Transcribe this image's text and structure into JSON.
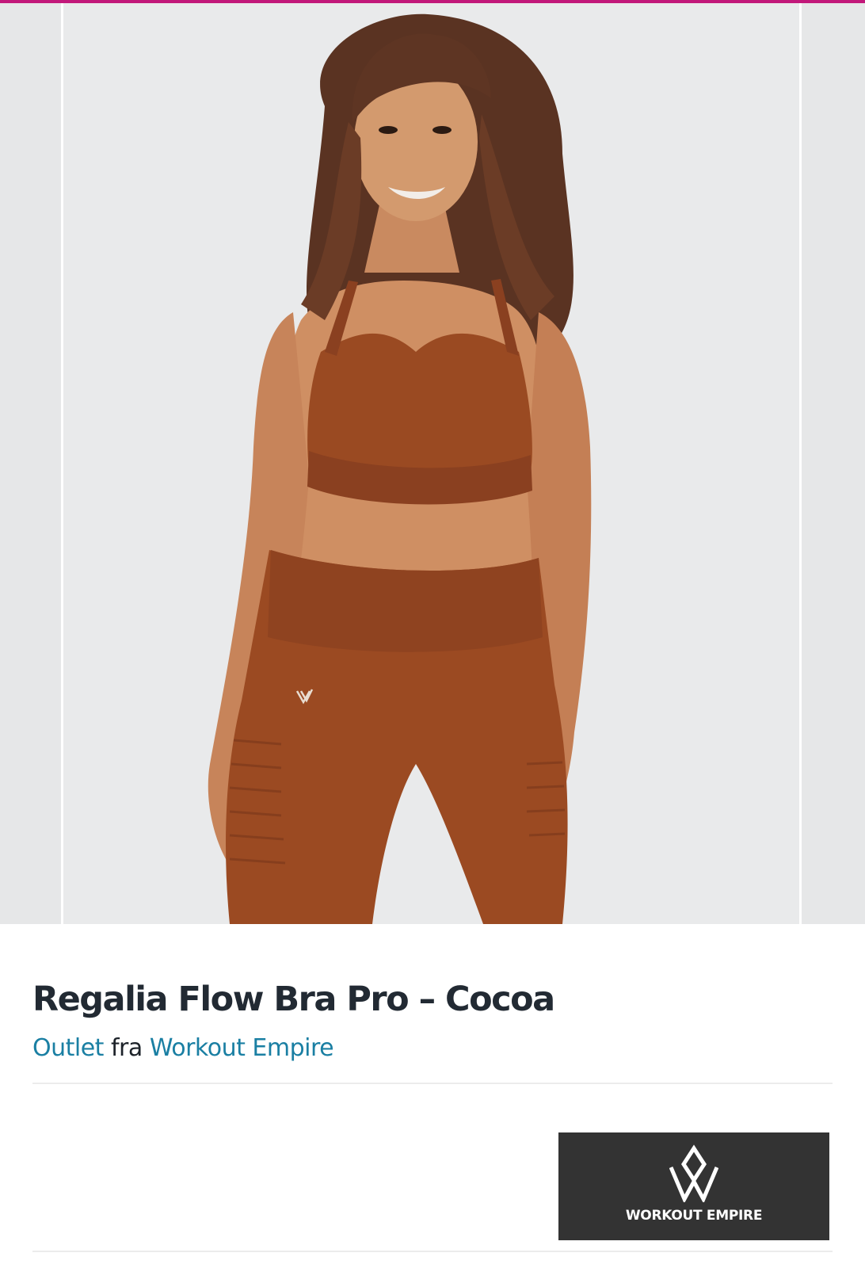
{
  "product": {
    "title": "Regalia Flow Bra Pro – Cocoa",
    "category_link": "Outlet",
    "from_word": "fra",
    "brand_link": "Workout Empire"
  },
  "brand_logo": {
    "name": "WORKOUT EMPIRE",
    "background": "#333333"
  },
  "colors": {
    "accent_bar": "#c2187a",
    "link": "#1a7fa3",
    "title": "#222a33",
    "garment": "#9a4a22"
  }
}
